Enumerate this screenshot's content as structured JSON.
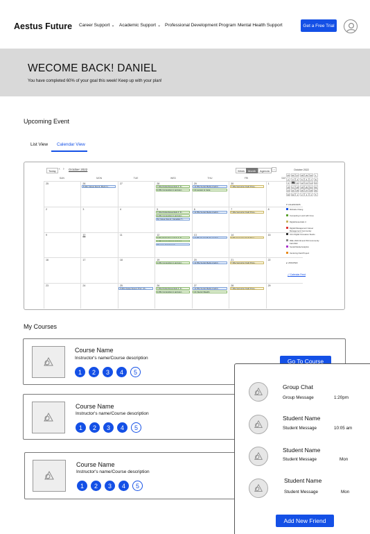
{
  "header": {
    "logo": "Aestus Future",
    "nav": [
      {
        "label": "Career Support",
        "has_dropdown": true
      },
      {
        "label": "Academic Support",
        "has_dropdown": true
      },
      {
        "label": "Professional Development Program",
        "has_dropdown": false
      },
      {
        "label": "Mental Health Support",
        "has_dropdown": false
      }
    ],
    "trial_button": "Get a Free Trial",
    "user_icon": "user-avatar-icon"
  },
  "banner": {
    "title": "WECOME BACK!  DANIEL",
    "subtitle": "You have completed 60% of your goal this week! Keep up with your plan!"
  },
  "upcoming": {
    "title": "Upcoming Event",
    "tabs": [
      {
        "label": "List View",
        "active": false
      },
      {
        "label": "Calendar View",
        "active": true
      }
    ]
  },
  "calendar": {
    "today": "Today",
    "prev": "‹",
    "next": "›",
    "month_label": "October 2022",
    "views": [
      "Week",
      "Month",
      "Agenda"
    ],
    "weekdays": [
      "SUN",
      "MON",
      "TUE",
      "WED",
      "THU",
      "FRI",
      "SAT"
    ],
    "weeks": [
      [
        "25",
        "26",
        "27",
        "28",
        "29",
        "30",
        "1"
      ],
      [
        "2",
        "3",
        "4",
        "5",
        "6",
        "7",
        "8"
      ],
      [
        "9",
        "10",
        "11",
        "12",
        "13",
        "14",
        "15"
      ],
      [
        "16",
        "17",
        "18",
        "19",
        "20",
        "21",
        "22"
      ],
      [
        "23",
        "24",
        "25",
        "26",
        "27",
        "28",
        "29"
      ]
    ],
    "events": [
      {
        "week": 0,
        "day": 1,
        "row": 0,
        "text": "5:30p Career Event: Mock In...",
        "color": "blue"
      },
      {
        "week": 0,
        "day": 3,
        "row": 0,
        "text": "7:00a Digital Essentials 4: D...",
        "color": "green"
      },
      {
        "week": 0,
        "day": 3,
        "row": 1,
        "text": "2:25p Computing in and wel...",
        "color": "green"
      },
      {
        "week": 0,
        "day": 4,
        "row": 0,
        "text": "11:05a Social Media Analyti...",
        "color": "blue"
      },
      {
        "week": 0,
        "day": 4,
        "row": 1,
        "text": "2p Lesson to route",
        "color": "green"
      },
      {
        "week": 0,
        "day": 5,
        "row": 0,
        "text": "7:00a Venturing Field Proje...",
        "color": "yellow"
      },
      {
        "week": 1,
        "day": 3,
        "row": 0,
        "text": "7:00a Digital Essentials 4: D...",
        "color": "green"
      },
      {
        "week": 1,
        "day": 3,
        "row": 1,
        "text": "2:25p Computing in and wel...",
        "color": "green"
      },
      {
        "week": 1,
        "day": 3,
        "row": 2,
        "text": "6p Career Event: Canadian T...",
        "color": "blue"
      },
      {
        "week": 1,
        "day": 4,
        "row": 0,
        "text": "11:05a Social Media Analyti...",
        "color": "blue"
      },
      {
        "week": 1,
        "day": 5,
        "row": 0,
        "text": "7:00a Venturing Field Proje...",
        "color": "yellow"
      },
      {
        "week": 2,
        "day": 3,
        "row": 0,
        "text": "7:00a Digital Essentials 4: D...",
        "color": "green"
      },
      {
        "week": 2,
        "day": 3,
        "row": 1,
        "text": "2:25p Computing in and wel...",
        "color": "green"
      },
      {
        "week": 2,
        "day": 3,
        "row": 2,
        "text": "Resume Assignment",
        "color": "blue"
      },
      {
        "week": 2,
        "day": 4,
        "row": 0,
        "text": "11:05a Social Media Analyti...",
        "color": "blue"
      },
      {
        "week": 2,
        "day": 5,
        "row": 0,
        "text": "7:00a Venturing Field Proje...",
        "color": "yellow"
      },
      {
        "week": 3,
        "day": 3,
        "row": 0,
        "text": "2:25p Computing in and wel...",
        "color": "green"
      },
      {
        "week": 3,
        "day": 4,
        "row": 0,
        "text": "11:05a Social Media Analyti...",
        "color": "blue"
      },
      {
        "week": 3,
        "day": 5,
        "row": 0,
        "text": "7:00a Venturing Field Proje...",
        "color": "yellow"
      },
      {
        "week": 4,
        "day": 2,
        "row": 0,
        "text": "5:30p Career Event: Prof. Ch...",
        "color": "blue"
      },
      {
        "week": 4,
        "day": 3,
        "row": 0,
        "text": "7:00a Digital Essentials 4: D...",
        "color": "green"
      },
      {
        "week": 4,
        "day": 3,
        "row": 1,
        "text": "2:25p Computing in and wel...",
        "color": "green"
      },
      {
        "week": 4,
        "day": 4,
        "row": 0,
        "text": "11:05a Social Media Analyti...",
        "color": "blue"
      },
      {
        "week": 4,
        "day": 4,
        "row": 1,
        "text": "2p Interior Readin",
        "color": "green"
      },
      {
        "week": 4,
        "day": 5,
        "row": 0,
        "text": "7:00a Venturing Field Proje...",
        "color": "yellow"
      }
    ],
    "mini": {
      "month_label": "October 2022",
      "days": [
        [
          "25",
          "26",
          "27",
          "28",
          "29",
          "30",
          "1"
        ],
        [
          "2",
          "3",
          "4",
          "5",
          "6",
          "7",
          "8"
        ],
        [
          "9",
          "10",
          "11",
          "12",
          "13",
          "14",
          "15"
        ],
        [
          "16",
          "17",
          "18",
          "19",
          "20",
          "21",
          "22"
        ],
        [
          "23",
          "24",
          "25",
          "26",
          "27",
          "28",
          "29"
        ],
        [
          "30",
          "31",
          "1",
          "2",
          "3",
          "4",
          "5"
        ]
      ],
      "today": "10"
    },
    "calendars_heading": "CALENDARS",
    "calendar_list": [
      {
        "name": "Michelle Chang",
        "color": "#1450e6"
      },
      {
        "name": "Computing in and with Crea",
        "color": "#5aa02c"
      },
      {
        "name": "Digital Essentials 4",
        "color": "#c9b561"
      },
      {
        "name": "Digital Management Career Management Community",
        "color": "#d33"
      },
      {
        "name": "Intro Digital Innovation Studio",
        "color": "#333"
      },
      {
        "name": "IDEL 2022 All and ISS Community Fall 2022",
        "color": "#888"
      },
      {
        "name": "Social Media Analytics",
        "color": "#a3c"
      },
      {
        "name": "Venturing Field Project",
        "color": "#e88a1a"
      }
    ],
    "undated_heading": "UNDATED",
    "feed_link": "Calendar Feed"
  },
  "courses": {
    "title": "My Courses",
    "items": [
      {
        "name": "Course Name",
        "description": "Instructor's name/Course description",
        "steps": [
          "1",
          "2",
          "3",
          "4",
          "5"
        ],
        "button": "Go To Course"
      },
      {
        "name": "Course Name",
        "description": "Instructor's name/Course description",
        "steps": [
          "1",
          "2",
          "3",
          "4",
          "5"
        ]
      },
      {
        "name": "Course Name",
        "description": "Instructor's name/Course description",
        "steps": [
          "1",
          "2",
          "3",
          "4",
          "5"
        ]
      }
    ]
  },
  "chat": {
    "items": [
      {
        "name": "Group Chat",
        "message": "Group Message",
        "time": "1:20pm"
      },
      {
        "name": "Student Name",
        "message": "Student Message",
        "time": "10:05 am"
      },
      {
        "name": "Student Name",
        "message": "Student Message",
        "time": "Mon"
      },
      {
        "name": "Student Name",
        "message": "Student Message",
        "time": "Mon"
      }
    ],
    "add_button": "Add New Friend"
  },
  "colors": {
    "accent": "#1450e6",
    "banner_bg": "#d9d9d9"
  }
}
